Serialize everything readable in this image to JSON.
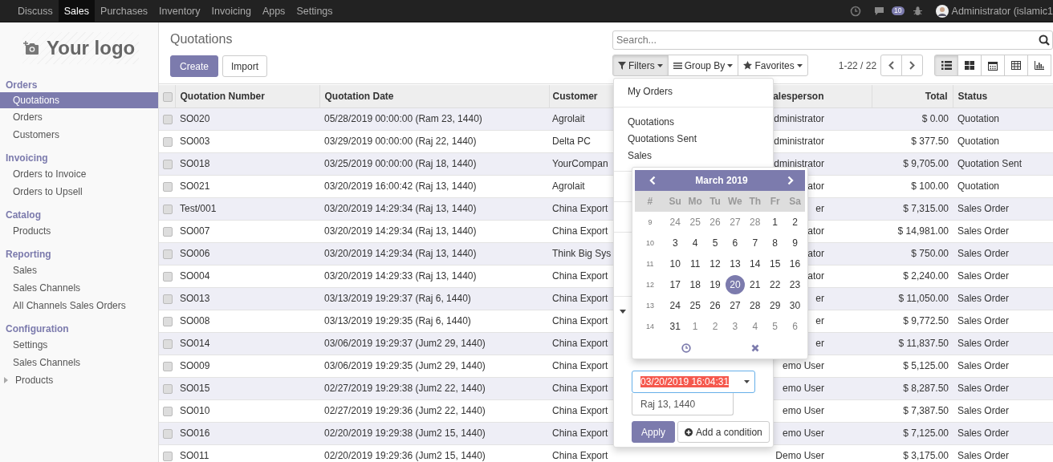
{
  "top_nav": {
    "apps": [
      {
        "label": "Discuss",
        "selected": false
      },
      {
        "label": "Sales",
        "selected": true
      },
      {
        "label": "Purchases",
        "selected": false
      },
      {
        "label": "Inventory",
        "selected": false
      },
      {
        "label": "Invoicing",
        "selected": false
      },
      {
        "label": "Apps",
        "selected": false
      },
      {
        "label": "Settings",
        "selected": false
      }
    ],
    "chat_count": "10",
    "user": "Administrator (islamic1"
  },
  "sidebar": {
    "logo": "Your logo",
    "sections": [
      {
        "title": "Orders",
        "items": [
          {
            "label": "Quotations",
            "kind": "link",
            "selected": true
          },
          {
            "label": "Orders",
            "kind": "link",
            "selected": false
          },
          {
            "label": "Customers",
            "kind": "link",
            "selected": false
          }
        ]
      },
      {
        "title": "Invoicing",
        "items": [
          {
            "label": "Orders to Invoice",
            "kind": "link",
            "selected": false
          },
          {
            "label": "Orders to Upsell",
            "kind": "link",
            "selected": false
          }
        ]
      },
      {
        "title": "Catalog",
        "items": [
          {
            "label": "Products",
            "kind": "link",
            "selected": false
          }
        ]
      },
      {
        "title": "Reporting",
        "items": [
          {
            "label": "Sales",
            "kind": "link",
            "selected": false
          },
          {
            "label": "Sales Channels",
            "kind": "link",
            "selected": false
          },
          {
            "label": "All Channels Sales Orders",
            "kind": "link",
            "selected": false
          }
        ]
      },
      {
        "title": "Configuration",
        "items": [
          {
            "label": "Settings",
            "kind": "link",
            "selected": false
          },
          {
            "label": "Sales Channels",
            "kind": "link",
            "selected": false
          },
          {
            "label": "Products",
            "kind": "folder",
            "selected": false,
            "expanded": false
          }
        ]
      }
    ]
  },
  "control_panel": {
    "title": "Quotations",
    "create": "Create",
    "import": "Import",
    "search": {
      "placeholder": "Search..."
    },
    "search_buttons": [
      {
        "kind": "filter",
        "label": "Filters",
        "selected": true
      },
      {
        "kind": "group",
        "label": "Group By",
        "selected": false
      },
      {
        "kind": "star",
        "label": "Favorites",
        "selected": false
      }
    ],
    "pager": "1-22 / 22",
    "views": [
      {
        "kind": "list",
        "selected": true
      },
      {
        "kind": "kanban",
        "selected": false
      },
      {
        "kind": "calendar",
        "selected": false
      },
      {
        "kind": "pivot",
        "selected": false
      },
      {
        "kind": "graph",
        "selected": false
      }
    ]
  },
  "table": {
    "all_checked": false,
    "columns": [
      "Quotation Number",
      "Quotation Date",
      "Customer",
      "alesperson",
      "Total",
      "Status"
    ],
    "rows": [
      {
        "checked": false,
        "cells": [
          "SO020",
          "05/28/2019 00:00:00 (Ram 23, 1440)",
          "Agrolait",
          "dministrator",
          "$ 0.00",
          "Quotation"
        ]
      },
      {
        "checked": false,
        "cells": [
          "SO003",
          "03/29/2019 00:00:00 (Raj 22, 1440)",
          "Delta PC",
          "dministrator",
          "$ 377.50",
          "Quotation"
        ]
      },
      {
        "checked": false,
        "cells": [
          "SO018",
          "03/25/2019 00:00:00 (Raj 18, 1440)",
          "YourCompan",
          "dministrator",
          "$ 9,705.00",
          "Quotation Sent"
        ]
      },
      {
        "checked": false,
        "cells": [
          "SO021",
          "03/20/2019 16:00:42 (Raj 13, 1440)",
          "Agrolait",
          "ator",
          "$ 100.00",
          "Quotation"
        ]
      },
      {
        "checked": false,
        "cells": [
          "Test/001",
          "03/20/2019 14:29:34 (Raj 13, 1440)",
          "China Export",
          "er",
          "$ 7,315.00",
          "Sales Order"
        ]
      },
      {
        "checked": false,
        "cells": [
          "SO007",
          "03/20/2019 14:29:34 (Raj 13, 1440)",
          "China Export",
          "ator",
          "$ 14,981.00",
          "Sales Order"
        ]
      },
      {
        "checked": false,
        "cells": [
          "SO006",
          "03/20/2019 14:29:34 (Raj 13, 1440)",
          "Think Big Sys",
          "ator",
          "$ 750.00",
          "Sales Order"
        ]
      },
      {
        "checked": false,
        "cells": [
          "SO004",
          "03/20/2019 14:29:33 (Raj 13, 1440)",
          "China Export",
          "ator",
          "$ 2,240.00",
          "Sales Order"
        ]
      },
      {
        "checked": false,
        "cells": [
          "SO013",
          "03/13/2019 19:29:37 (Raj 6, 1440)",
          "China Export",
          "er",
          "$ 11,050.00",
          "Sales Order"
        ]
      },
      {
        "checked": false,
        "cells": [
          "SO008",
          "03/13/2019 19:29:35 (Raj 6, 1440)",
          "China Export",
          "er",
          "$ 9,772.50",
          "Sales Order"
        ]
      },
      {
        "checked": false,
        "cells": [
          "SO014",
          "03/06/2019 19:29:37 (Jum2 29, 1440)",
          "China Export",
          "er",
          "$ 11,837.50",
          "Sales Order"
        ]
      },
      {
        "checked": false,
        "cells": [
          "SO009",
          "03/06/2019 19:29:35 (Jum2 29, 1440)",
          "China Export",
          "emo User",
          "$ 5,125.00",
          "Sales Order"
        ]
      },
      {
        "checked": false,
        "cells": [
          "SO015",
          "02/27/2019 19:29:38 (Jum2 22, 1440)",
          "China Export",
          "emo User",
          "$ 8,287.50",
          "Sales Order"
        ]
      },
      {
        "checked": false,
        "cells": [
          "SO010",
          "02/27/2019 19:29:36 (Jum2 22, 1440)",
          "China Export",
          "emo User",
          "$ 7,387.50",
          "Sales Order"
        ]
      },
      {
        "checked": false,
        "cells": [
          "SO016",
          "02/20/2019 19:29:38 (Jum2 15, 1440)",
          "China Export",
          "emo User",
          "$ 7,125.00",
          "Sales Order"
        ]
      },
      {
        "checked": false,
        "cells": [
          "SO011",
          "02/20/2019 19:29:36 (Jum2 15, 1440)",
          "China Export",
          "Demo User",
          "$ 3,175.00",
          "Sales Order"
        ]
      }
    ]
  },
  "filter_menu": {
    "groups": [
      [
        "My Orders"
      ],
      [
        "Quotations",
        "Quotations Sent",
        "Sales"
      ]
    ],
    "custom": {
      "expanded": true,
      "date_value": "03/20/2019 16:04:31",
      "hijri_value": "Raj 13, 1440",
      "apply": "Apply",
      "add": "Add a condition"
    }
  },
  "calendar": {
    "title": "March 2019",
    "week_label": "#",
    "weekdays": [
      "Su",
      "Mo",
      "Tu",
      "We",
      "Th",
      "Fr",
      "Sa"
    ],
    "weeks": [
      {
        "week": "9",
        "days": [
          {
            "d": "24",
            "other": true,
            "selected": false
          },
          {
            "d": "25",
            "other": true,
            "selected": false
          },
          {
            "d": "26",
            "other": true,
            "selected": false
          },
          {
            "d": "27",
            "other": true,
            "selected": false
          },
          {
            "d": "28",
            "other": true,
            "selected": false
          },
          {
            "d": "1",
            "other": false,
            "selected": false
          },
          {
            "d": "2",
            "other": false,
            "selected": false
          }
        ]
      },
      {
        "week": "10",
        "days": [
          {
            "d": "3",
            "other": false,
            "selected": false
          },
          {
            "d": "4",
            "other": false,
            "selected": false
          },
          {
            "d": "5",
            "other": false,
            "selected": false
          },
          {
            "d": "6",
            "other": false,
            "selected": false
          },
          {
            "d": "7",
            "other": false,
            "selected": false
          },
          {
            "d": "8",
            "other": false,
            "selected": false
          },
          {
            "d": "9",
            "other": false,
            "selected": false
          }
        ]
      },
      {
        "week": "11",
        "days": [
          {
            "d": "10",
            "other": false,
            "selected": false
          },
          {
            "d": "11",
            "other": false,
            "selected": false
          },
          {
            "d": "12",
            "other": false,
            "selected": false
          },
          {
            "d": "13",
            "other": false,
            "selected": false
          },
          {
            "d": "14",
            "other": false,
            "selected": false
          },
          {
            "d": "15",
            "other": false,
            "selected": false
          },
          {
            "d": "16",
            "other": false,
            "selected": false
          }
        ]
      },
      {
        "week": "12",
        "days": [
          {
            "d": "17",
            "other": false,
            "selected": false
          },
          {
            "d": "18",
            "other": false,
            "selected": false
          },
          {
            "d": "19",
            "other": false,
            "selected": false
          },
          {
            "d": "20",
            "other": false,
            "selected": true
          },
          {
            "d": "21",
            "other": false,
            "selected": false
          },
          {
            "d": "22",
            "other": false,
            "selected": false
          },
          {
            "d": "23",
            "other": false,
            "selected": false
          }
        ]
      },
      {
        "week": "13",
        "days": [
          {
            "d": "24",
            "other": false,
            "selected": false
          },
          {
            "d": "25",
            "other": false,
            "selected": false
          },
          {
            "d": "26",
            "other": false,
            "selected": false
          },
          {
            "d": "27",
            "other": false,
            "selected": false
          },
          {
            "d": "28",
            "other": false,
            "selected": false
          },
          {
            "d": "29",
            "other": false,
            "selected": false
          },
          {
            "d": "30",
            "other": false,
            "selected": false
          }
        ]
      },
      {
        "week": "14",
        "days": [
          {
            "d": "31",
            "other": false,
            "selected": false
          },
          {
            "d": "1",
            "other": true,
            "selected": false
          },
          {
            "d": "2",
            "other": true,
            "selected": false
          },
          {
            "d": "3",
            "other": true,
            "selected": false
          },
          {
            "d": "4",
            "other": true,
            "selected": false
          },
          {
            "d": "5",
            "other": true,
            "selected": false
          },
          {
            "d": "6",
            "other": true,
            "selected": false
          }
        ]
      }
    ]
  }
}
